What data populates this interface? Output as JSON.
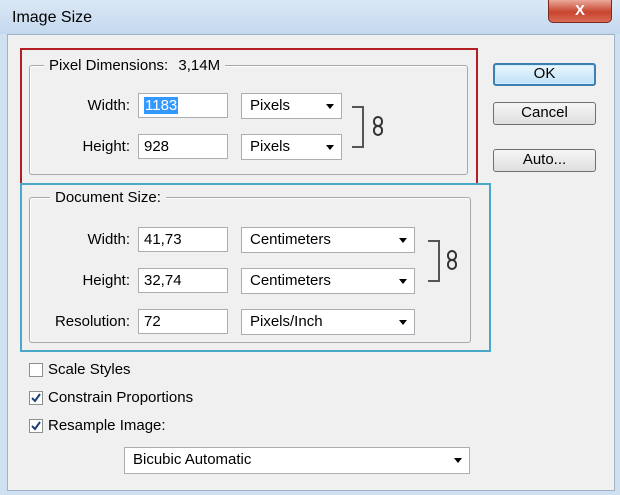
{
  "window": {
    "title": "Image Size",
    "close_glyph": "X"
  },
  "pixel_dimensions": {
    "legend": "Pixel Dimensions:",
    "size_value": "3,14M",
    "width_label": "Width:",
    "width_value": "1183",
    "width_unit": "Pixels",
    "height_label": "Height:",
    "height_value": "928",
    "height_unit": "Pixels"
  },
  "document_size": {
    "legend": "Document Size:",
    "width_label": "Width:",
    "width_value": "41,73",
    "width_unit": "Centimeters",
    "height_label": "Height:",
    "height_value": "32,74",
    "height_unit": "Centimeters",
    "resolution_label": "Resolution:",
    "resolution_value": "72",
    "resolution_unit": "Pixels/Inch"
  },
  "buttons": {
    "ok": "OK",
    "cancel": "Cancel",
    "auto": "Auto..."
  },
  "options": {
    "scale_styles": {
      "label": "Scale Styles",
      "checked": false
    },
    "constrain_proportions": {
      "label": "Constrain Proportions",
      "checked": true
    },
    "resample_image": {
      "label": "Resample Image:",
      "checked": true
    }
  },
  "resample_method": "Bicubic Automatic",
  "colors": {
    "highlight_red": "#b21f24",
    "highlight_blue": "#49a7c7",
    "selection": "#3399ff",
    "default_button_border": "#3c7fb1"
  },
  "icons": {
    "link": "chain-link-icon",
    "check": "checkmark-icon",
    "dropdown": "chevron-down-icon"
  }
}
